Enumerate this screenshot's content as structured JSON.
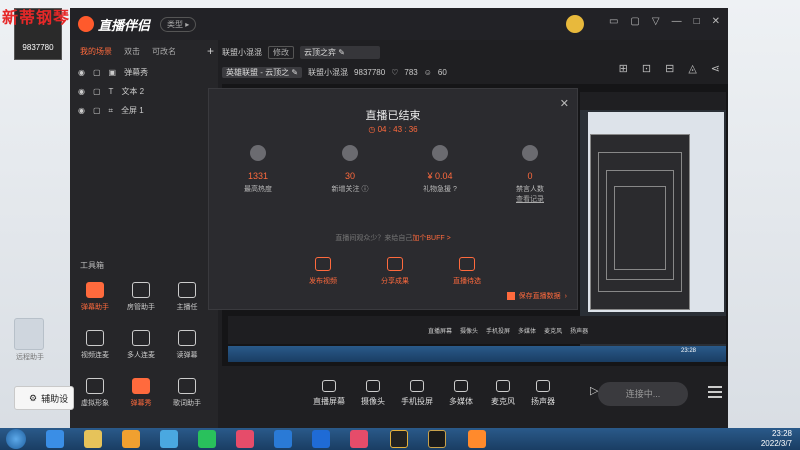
{
  "overlay": {
    "watermark": "新蒂钢琴",
    "corner_count": "9837780",
    "desktop_icon_label": "远程助手",
    "assist_button": "辅助设"
  },
  "app": {
    "title": "直播伴侣",
    "type_button": "类型",
    "accent": "#ff6a3d"
  },
  "scenes": {
    "tabs": [
      "我的场景",
      "双击",
      "可改名"
    ],
    "sources": [
      {
        "label": "弹幕秀"
      },
      {
        "label": "文本 2"
      },
      {
        "label": "全屏 1"
      }
    ]
  },
  "toolbox": {
    "title": "工具箱",
    "tools": [
      {
        "label": "弹幕助手",
        "highlight": true
      },
      {
        "label": "房管助手",
        "highlight": false
      },
      {
        "label": "主播任",
        "highlight": false
      },
      {
        "label": "视频连麦",
        "highlight": false
      },
      {
        "label": "多人连麦",
        "highlight": false
      },
      {
        "label": "读弹幕",
        "highlight": false
      },
      {
        "label": "虚拟形象",
        "highlight": false
      },
      {
        "label": "弹幕秀",
        "highlight": true
      },
      {
        "label": "歌词助手",
        "highlight": false
      }
    ]
  },
  "info": {
    "room_name": "联盟小混混",
    "edit": "修改",
    "title_value": "云顶之弈",
    "category": "英雄联盟 - 云顶之",
    "account": "联盟小混混",
    "uid": "9837780",
    "likes": "783",
    "fans": "60"
  },
  "dialog": {
    "title": "直播已结束",
    "duration": "04 : 43 : 36",
    "stats": [
      {
        "value": "1331",
        "caption": "最高热度",
        "link": ""
      },
      {
        "value": "30",
        "caption": "新增关注",
        "link": ""
      },
      {
        "value": "¥ 0.04",
        "caption": "礼物急援",
        "link": ""
      },
      {
        "value": "0",
        "caption": "禁言人数",
        "link": "查看记录"
      }
    ],
    "tip_prefix": "直播间观众少？来给自己",
    "tip_link": "加个BUFF >",
    "actions": [
      "发布视频",
      "分享成果",
      "直播待选"
    ],
    "save_data": "保存直播数据"
  },
  "bottom_bar": {
    "items": [
      "直播屏幕",
      "摄像头",
      "手机投屏",
      "多媒体",
      "麦克风",
      "扬声器"
    ],
    "live_button": "连接中..."
  },
  "nested": {
    "bar_items": [
      "直播屏幕",
      "摄像头",
      "手机投屏",
      "多媒体",
      "麦克风",
      "扬声器"
    ],
    "clock": "23:28"
  },
  "taskbar": {
    "time": "23:28",
    "date": "2022/3/7"
  }
}
